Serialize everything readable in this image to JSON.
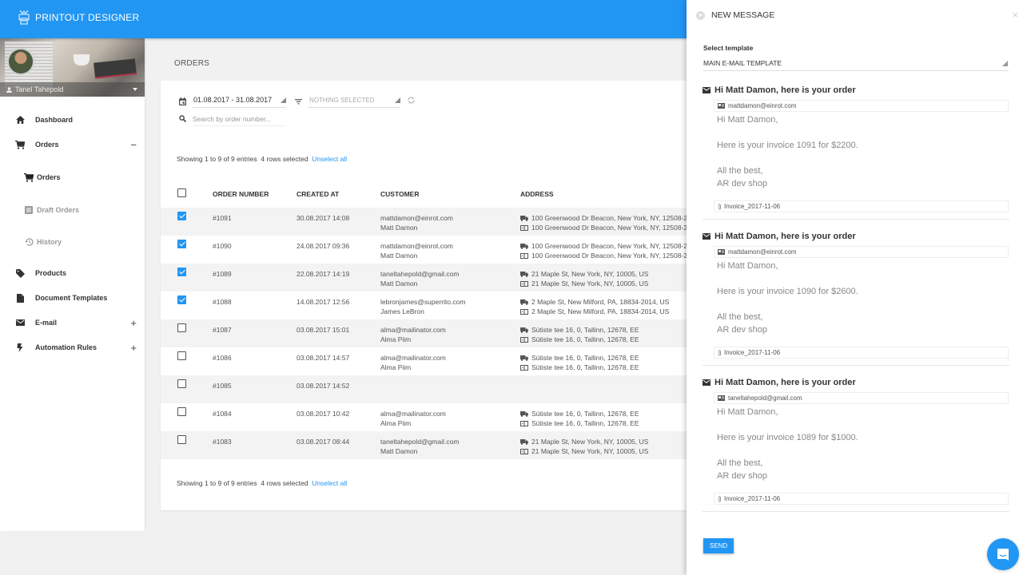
{
  "app": {
    "brand_name": "PRINTOUT DESIGNER",
    "brand_color": "#2196f3"
  },
  "user": {
    "name": "Tanel Tahepold"
  },
  "sidebar": {
    "items": [
      {
        "label": "Dashboard",
        "icon": "home-icon",
        "toggle": ""
      },
      {
        "label": "Orders",
        "icon": "cart-icon",
        "toggle": "−"
      },
      {
        "label": "Orders",
        "icon": "cart-icon",
        "toggle": "",
        "sub": true,
        "active": true
      },
      {
        "label": "Draft Orders",
        "icon": "list-icon",
        "toggle": "",
        "sub": true
      },
      {
        "label": "History",
        "icon": "history-icon",
        "toggle": "",
        "sub": true
      },
      {
        "label": "Products",
        "icon": "tag-icon",
        "toggle": ""
      },
      {
        "label": "Document Templates",
        "icon": "document-icon",
        "toggle": ""
      },
      {
        "label": "E-mail",
        "icon": "mail-icon",
        "toggle": "+"
      },
      {
        "label": "Automation Rules",
        "icon": "lightning-icon",
        "toggle": "+"
      }
    ]
  },
  "main": {
    "title": "ORDERS",
    "filters": {
      "date_range": "01.08.2017 - 31.08.2017",
      "status_placeholder": "NOTHING SELECTED",
      "search_placeholder": "Search by order number...",
      "search_value": ""
    },
    "summary": {
      "showing": "Showing 1 to 9 of 9 entries",
      "selected": "4 rows selected",
      "unselect_label": "Unselect all"
    },
    "table": {
      "columns": [
        "ORDER NUMBER",
        "CREATED AT",
        "CUSTOMER",
        "ADDRESS"
      ],
      "rows": [
        {
          "checked": true,
          "number": "#1091",
          "created": "30.08.2017 14:08",
          "email": "mattdamon@einrot.com",
          "name": "Matt Damon",
          "shipping": "100 Greenwood Dr Beacon, New York, NY, 12508-2",
          "billing": "100 Greenwood Dr Beacon, New York, NY, 12508-2"
        },
        {
          "checked": true,
          "number": "#1090",
          "created": "24.08.2017 09:36",
          "email": "mattdamon@einrot.com",
          "name": "Matt Damon",
          "shipping": "100 Greenwood Dr Beacon, New York, NY, 12508-2",
          "billing": "100 Greenwood Dr Beacon, New York, NY, 12508-2"
        },
        {
          "checked": true,
          "number": "#1089",
          "created": "22.08.2017 14:19",
          "email": "taneltahepold@gmail.com",
          "name": "Matt Damon",
          "shipping": "21 Maple St, New York, NY, 10005, US",
          "billing": "21 Maple St, New York, NY, 10005, US"
        },
        {
          "checked": true,
          "number": "#1088",
          "created": "14.08.2017 12:56",
          "email": "lebronjames@superrito.com",
          "name": "James LeBron",
          "shipping": "2 Maple St, New Milford, PA, 18834-2014, US",
          "billing": "2 Maple St, New Milford, PA, 18834-2014, US"
        },
        {
          "checked": false,
          "number": "#1087",
          "created": "03.08.2017 15:01",
          "email": "alma@mailinator.com",
          "name": "Alma Piim",
          "shipping": "Sütiste tee 16, 0, Tallinn, 12678, EE",
          "billing": "Sütiste tee 16, 0, Tallinn, 12678, EE"
        },
        {
          "checked": false,
          "number": "#1086",
          "created": "03.08.2017 14:57",
          "email": "alma@mailinator.com",
          "name": "Alma Piim",
          "shipping": "Sütiste tee 16, 0, Tallinn, 12678, EE",
          "billing": "Sütiste tee 16, 0, Tallinn, 12678, EE"
        },
        {
          "checked": false,
          "number": "#1085",
          "created": "03.08.2017 14:52",
          "email": "",
          "name": "",
          "shipping": "",
          "billing": ""
        },
        {
          "checked": false,
          "number": "#1084",
          "created": "03.08.2017 10:42",
          "email": "alma@mailinator.com",
          "name": "Alma Piim",
          "shipping": "Sütiste tee 16, 0, Tallinn, 12678, EE",
          "billing": "Sütiste tee 16, 0, Tallinn, 12678, EE"
        },
        {
          "checked": false,
          "number": "#1083",
          "created": "03.08.2017 08:44",
          "email": "taneltahepold@gmail.com",
          "name": "Matt Damon",
          "shipping": "21 Maple St, New York, NY, 10005, US",
          "billing": "21 Maple St, New York, NY, 10005, US"
        }
      ]
    }
  },
  "panel": {
    "title": "NEW MESSAGE",
    "close_label": "×",
    "template_label": "Select template",
    "template_value": "MAIN E-MAIL TEMPLATE",
    "messages": [
      {
        "subject": "Hi Matt Damon, here is your order",
        "to": "mattdamon@einrot.com",
        "body": "Hi Matt Damon,\n\nHere is your invoice 1091 for $2200.\n\nAll the best,\nAR dev shop",
        "attachment": "Invoice_2017-11-06"
      },
      {
        "subject": "Hi Matt Damon, here is your order",
        "to": "mattdamon@einrot.com",
        "body": "Hi Matt Damon,\n\nHere is your invoice 1090 for $2600.\n\nAll the best,\nAR dev shop",
        "attachment": "Invoice_2017-11-06"
      },
      {
        "subject": "Hi Matt Damon, here is your order",
        "to": "taneltahepold@gmail.com",
        "body": "Hi Matt Damon,\n\nHere is your invoice 1089 for $1000.\n\nAll the best,\nAR dev shop",
        "attachment": "Invoice_2017-11-06"
      }
    ],
    "send_label": "SEND"
  }
}
